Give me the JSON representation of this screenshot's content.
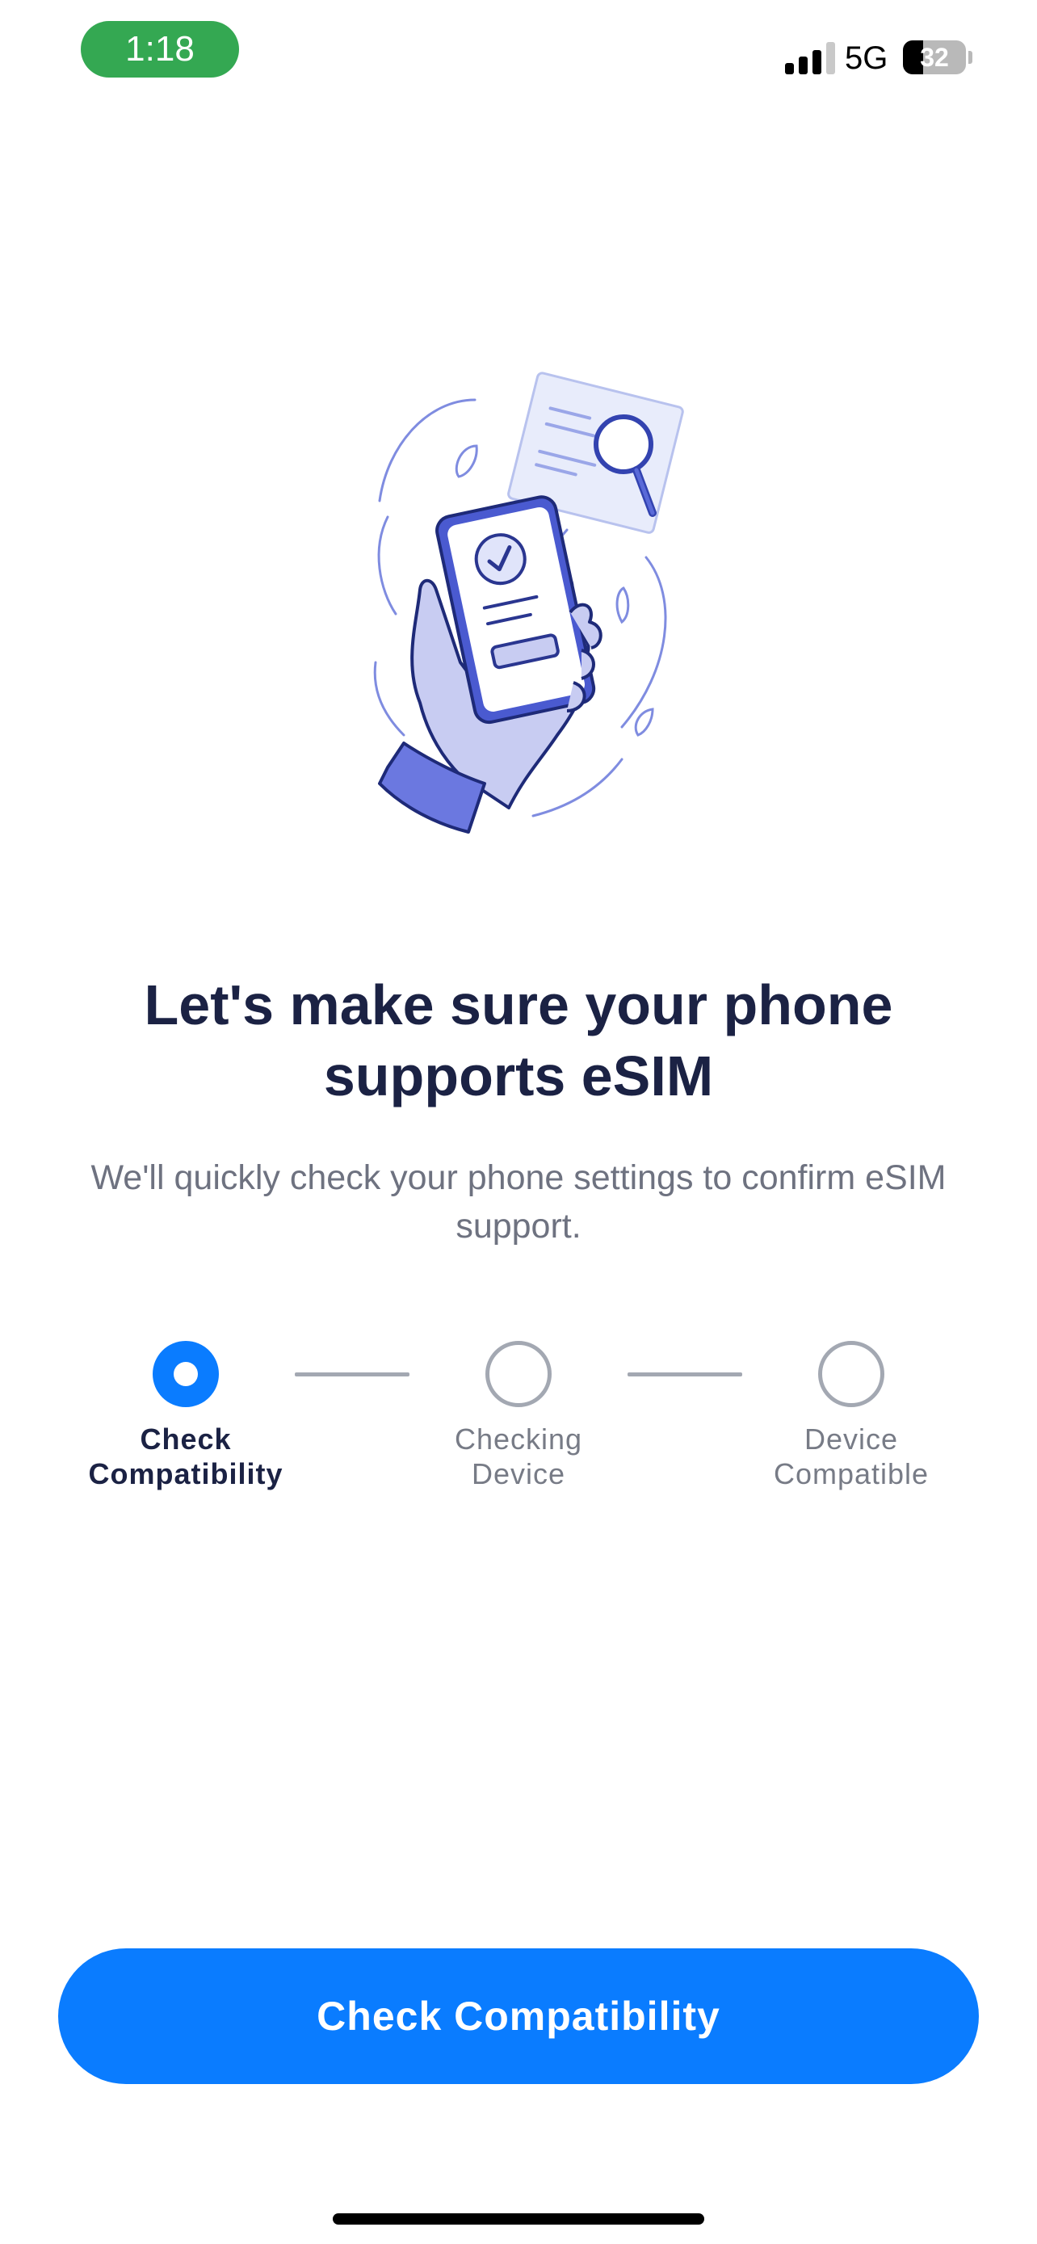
{
  "status_bar": {
    "time": "1:18",
    "network": "5G",
    "battery_percent": "32",
    "battery_level": 0.32,
    "signal_bars_active": 3,
    "signal_bars_total": 4,
    "time_pill_color": "#34a852"
  },
  "illustration": {
    "icon": "hand-holding-phone-with-checkmark-illustration",
    "accent_color": "#4a5ad0"
  },
  "main": {
    "title": "Let's make sure your phone supports eSIM",
    "subtitle": "We'll quickly check your phone settings to confirm eSIM support."
  },
  "steps": [
    {
      "label": "Check Compatibility",
      "state": "active"
    },
    {
      "label": "Checking Device",
      "state": "pending"
    },
    {
      "label": "Device Compatible",
      "state": "pending"
    }
  ],
  "primary_button": {
    "label": "Check Compatibility",
    "color": "#0a7cff"
  }
}
